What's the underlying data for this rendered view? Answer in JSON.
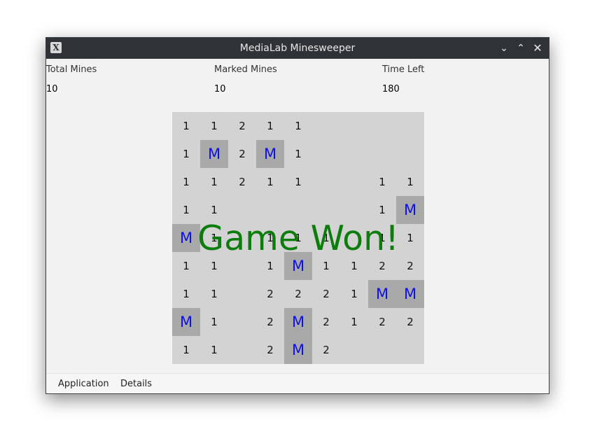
{
  "window": {
    "title": "MediaLab Minesweeper",
    "icon": "x11-app-icon"
  },
  "controls": {
    "minimize": "⌄",
    "maximize": "⌃",
    "close": "✕"
  },
  "info": {
    "total_mines_label": "Total Mines",
    "total_mines_value": "10",
    "marked_mines_label": "Marked Mines",
    "marked_mines_value": "10",
    "time_left_label": "Time Left",
    "time_left_value": "180"
  },
  "board": {
    "rows": [
      [
        "1",
        "1",
        "2",
        "1",
        "1",
        "",
        "",
        "",
        ""
      ],
      [
        "1",
        "M",
        "2",
        "M",
        "1",
        "",
        "",
        "",
        ""
      ],
      [
        "1",
        "1",
        "2",
        "1",
        "1",
        "",
        "",
        "1",
        "1"
      ],
      [
        "1",
        "1",
        "",
        "",
        "",
        "",
        "",
        "1",
        "M"
      ],
      [
        "M",
        "1",
        "",
        "1",
        "1",
        "1",
        "",
        "1",
        "1"
      ],
      [
        "1",
        "1",
        "",
        "1",
        "M",
        "1",
        "1",
        "2",
        "2"
      ],
      [
        "1",
        "1",
        "",
        "2",
        "2",
        "2",
        "1",
        "M",
        "M"
      ],
      [
        "M",
        "1",
        "",
        "2",
        "M",
        "2",
        "1",
        "2",
        "2"
      ],
      [
        "1",
        "1",
        "",
        "2",
        "M",
        "2",
        "",
        "",
        ""
      ]
    ]
  },
  "overlay": {
    "message": "Game Won!"
  },
  "menubar": {
    "items": [
      "Application",
      "Details"
    ]
  },
  "colors": {
    "mine_text": "#1010e0",
    "won_text": "#0c7d0c",
    "mine_cell": "#a9a9a9",
    "board_bg": "#d3d3d3"
  }
}
